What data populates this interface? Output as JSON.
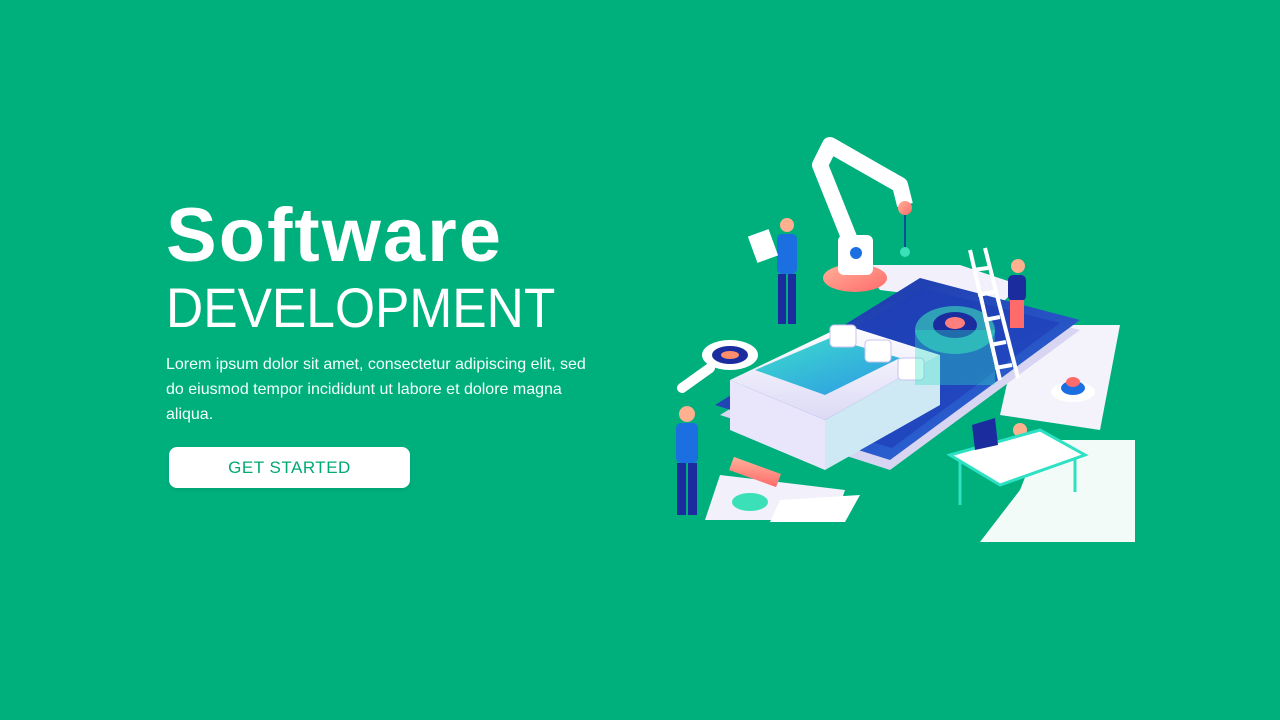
{
  "hero": {
    "title": "Software",
    "subtitle": "DEVELOPMENT",
    "description": "Lorem ipsum dolor sit amet, consectetur adipiscing elit, sed do eiusmod tempor incididunt ut labore et dolore magna aliqua.",
    "cta_label": "GET STARTED"
  },
  "colors": {
    "background": "#00b07c",
    "button_text": "#00a873",
    "button_bg": "#ffffff"
  },
  "illustration": {
    "icons": [
      "robotic-arm-icon",
      "smartphone-icon",
      "ladder-icon",
      "magnifier-icon",
      "gear-icon",
      "laptop-icon",
      "person-icon"
    ]
  }
}
